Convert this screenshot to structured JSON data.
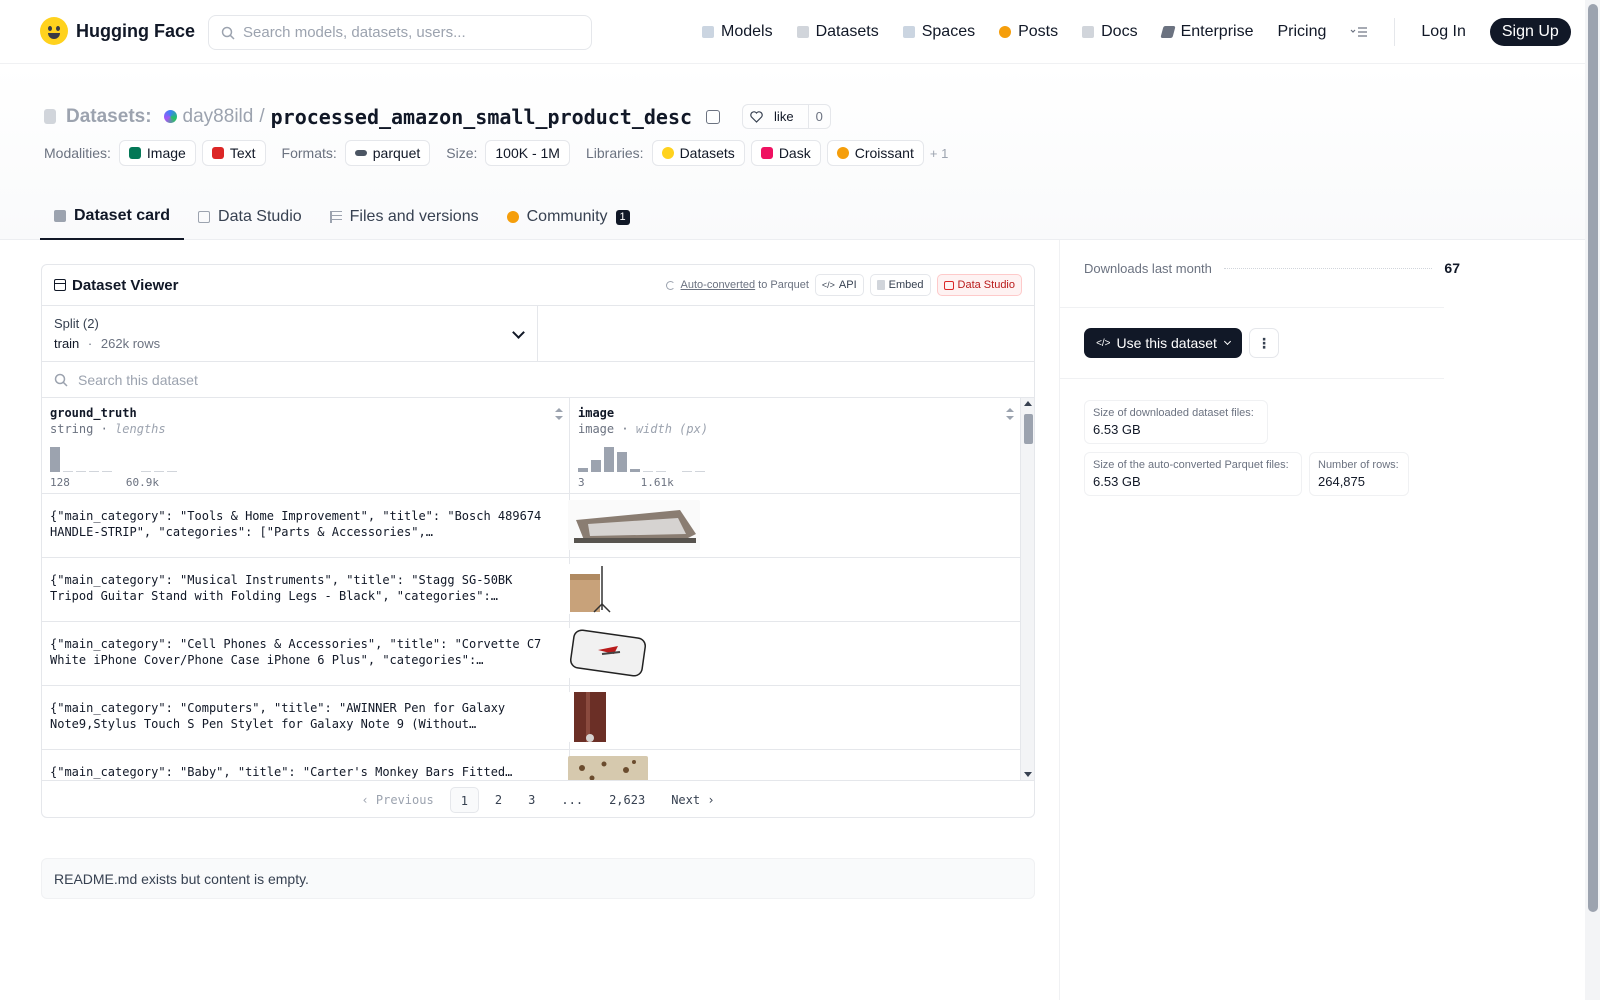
{
  "app": {
    "name": "Hugging Face"
  },
  "search": {
    "placeholder": "Search models, datasets, users..."
  },
  "nav": {
    "items": [
      {
        "label": "Models",
        "icon": "cube-icon",
        "color": "#9ca3af"
      },
      {
        "label": "Datasets",
        "icon": "database-icon",
        "color": "#9ca3af"
      },
      {
        "label": "Spaces",
        "icon": "grid-icon",
        "color": "#9ca3af"
      },
      {
        "label": "Posts",
        "icon": "chat-icon",
        "color": "#f59e0b"
      },
      {
        "label": "Docs",
        "icon": "book-icon",
        "color": "#9ca3af"
      },
      {
        "label": "Enterprise",
        "icon": "enterprise-icon",
        "color": "#6b7280"
      },
      {
        "label": "Pricing",
        "icon": "",
        "color": ""
      }
    ],
    "login": "Log In",
    "signup": "Sign Up"
  },
  "header": {
    "section_label": "Datasets:",
    "owner": "day88ild",
    "separator": "/",
    "repo": "processed_amazon_small_product_desc",
    "like_label": "like",
    "like_count": "0",
    "modalities_label": "Modalities:",
    "modalities": [
      "Image",
      "Text"
    ],
    "formats_label": "Formats:",
    "formats": [
      "parquet"
    ],
    "size_label": "Size:",
    "size": "100K - 1M",
    "libraries_label": "Libraries:",
    "libraries": [
      "Datasets",
      "Dask",
      "Croissant"
    ],
    "libraries_more": "+ 1"
  },
  "tabs": [
    {
      "label": "Dataset card",
      "active": true
    },
    {
      "label": "Data Studio",
      "active": false
    },
    {
      "label": "Files and versions",
      "active": false
    },
    {
      "label": "Community",
      "active": false,
      "badge": "1"
    }
  ],
  "viewer": {
    "title": "Dataset Viewer",
    "auto_converted": "Auto-converted",
    "to_parquet": "to Parquet",
    "api": "API",
    "embed": "Embed",
    "data_studio": "Data Studio",
    "split_label": "Split (2)",
    "split_value": "train",
    "split_dot": "·",
    "split_rows": "262k rows",
    "search_placeholder": "Search this dataset",
    "columns": [
      {
        "name": "ground_truth",
        "type": "string",
        "stat": "lengths",
        "min": "128",
        "max": "60.9k",
        "hist": [
          0.95,
          0.05,
          0.05,
          0.05,
          0.05,
          0,
          0,
          0.05,
          0.05,
          0.05
        ]
      },
      {
        "name": "image",
        "type": "image",
        "stat": "width (px)",
        "min": "3",
        "max": "1.61k",
        "hist": [
          0.15,
          0.45,
          0.95,
          0.75,
          0.1,
          0.05,
          0.05,
          0,
          0.05,
          0.05
        ]
      }
    ],
    "rows": [
      {
        "text": "{\"main_category\": \"Tools & Home Improvement\", \"title\": \"Bosch 489674 HANDLE-STRIP\", \"categories\": [\"Parts & Accessories\", \"Appliances\"],...",
        "image": "handle-strip-photo"
      },
      {
        "text": "{\"main_category\": \"Musical Instruments\", \"title\": \"Stagg SG-50BK Tripod Guitar Stand with Folding Legs - Black\", \"categories\": [\"Stands, Hanger...",
        "image": "guitar-stand-box-photo"
      },
      {
        "text": "{\"main_category\": \"Cell Phones & Accessories\", \"title\": \"Corvette C7 White iPhone Cover/Phone Case iPhone 6 Plus\", \"categories\": [\"Cases,...",
        "image": "phone-case-photo"
      },
      {
        "text": "{\"main_category\": \"Computers\", \"title\": \"AWINNER Pen for Galaxy Note9,Stylus Touch S Pen Stylet for Galaxy Note 9 (Without Bluetooth)-...",
        "image": "stylus-pen-photo"
      },
      {
        "text": "{\"main_category\": \"Baby\", \"title\": \"Carter's Monkey Bars Fitted Sheet...",
        "image": "fitted-sheet-photo"
      }
    ],
    "pager": {
      "previous": "Previous",
      "pages": [
        "1",
        "2",
        "3",
        "...",
        "2,623"
      ],
      "next": "Next",
      "current": "1"
    }
  },
  "readme": "README.md exists but content is empty.",
  "sidebar": {
    "downloads_label": "Downloads last month",
    "downloads_value": "67",
    "use_button": "Use this dataset",
    "stats": [
      {
        "label": "Size of downloaded dataset files:",
        "value": "6.53 GB"
      },
      {
        "label": "Size of the auto-converted Parquet files:",
        "value": "6.53 GB"
      },
      {
        "label": "Number of rows:",
        "value": "264,875"
      }
    ]
  }
}
